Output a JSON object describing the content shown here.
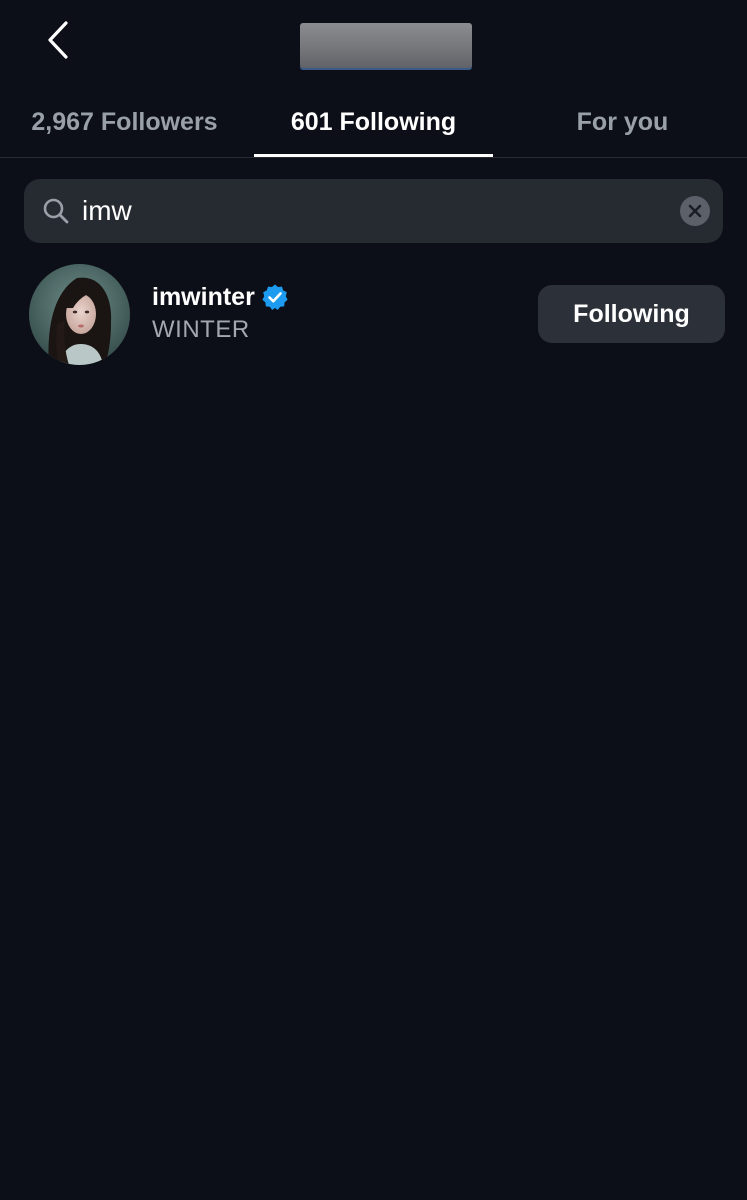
{
  "header": {
    "username_redacted": true
  },
  "tabs": [
    {
      "label": "2,967 Followers",
      "active": false
    },
    {
      "label": "601 Following",
      "active": true
    },
    {
      "label": "For you",
      "active": false
    }
  ],
  "search": {
    "value": "imw",
    "icon": "search-icon",
    "clear_icon": "close-icon"
  },
  "results": [
    {
      "username": "imwinter",
      "full_name": "WINTER",
      "verified": true,
      "follow_label": "Following"
    }
  ],
  "colors": {
    "background": "#0c0f17",
    "search_bg": "#262a31",
    "button_bg": "#2c3038",
    "verified_blue": "#1d9bf0",
    "muted_text": "#9aa0a8"
  }
}
